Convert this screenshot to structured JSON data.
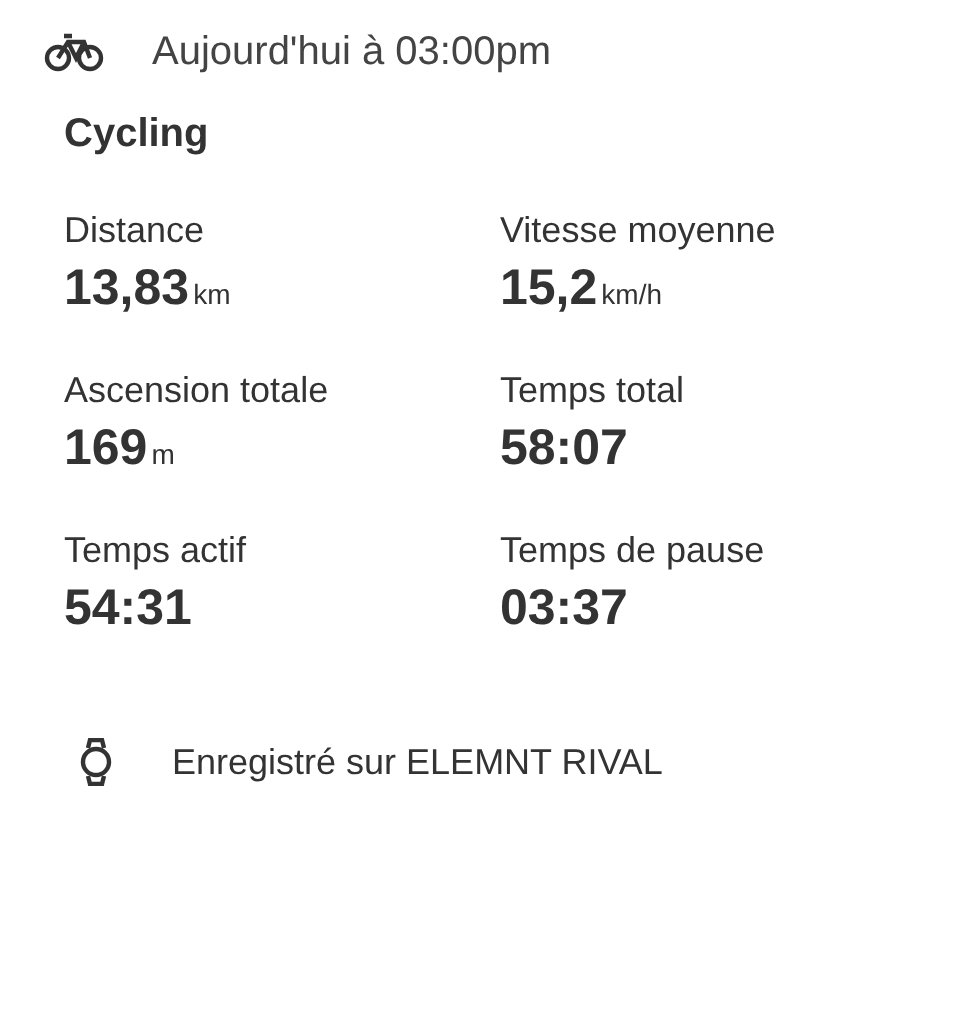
{
  "header": {
    "time": "Aujourd'hui à 03:00pm"
  },
  "activity": "Cycling",
  "stats": [
    {
      "label": "Distance",
      "value": "13,83",
      "unit": "km"
    },
    {
      "label": "Vitesse moyenne",
      "value": "15,2",
      "unit": "km/h"
    },
    {
      "label": "Ascension totale",
      "value": "169",
      "unit": "m"
    },
    {
      "label": "Temps total",
      "value": "58:07"
    },
    {
      "label": "Temps actif",
      "value": "54:31"
    },
    {
      "label": "Temps de pause",
      "value": "03:37"
    }
  ],
  "device": "Enregistré sur ELEMNT RIVAL"
}
